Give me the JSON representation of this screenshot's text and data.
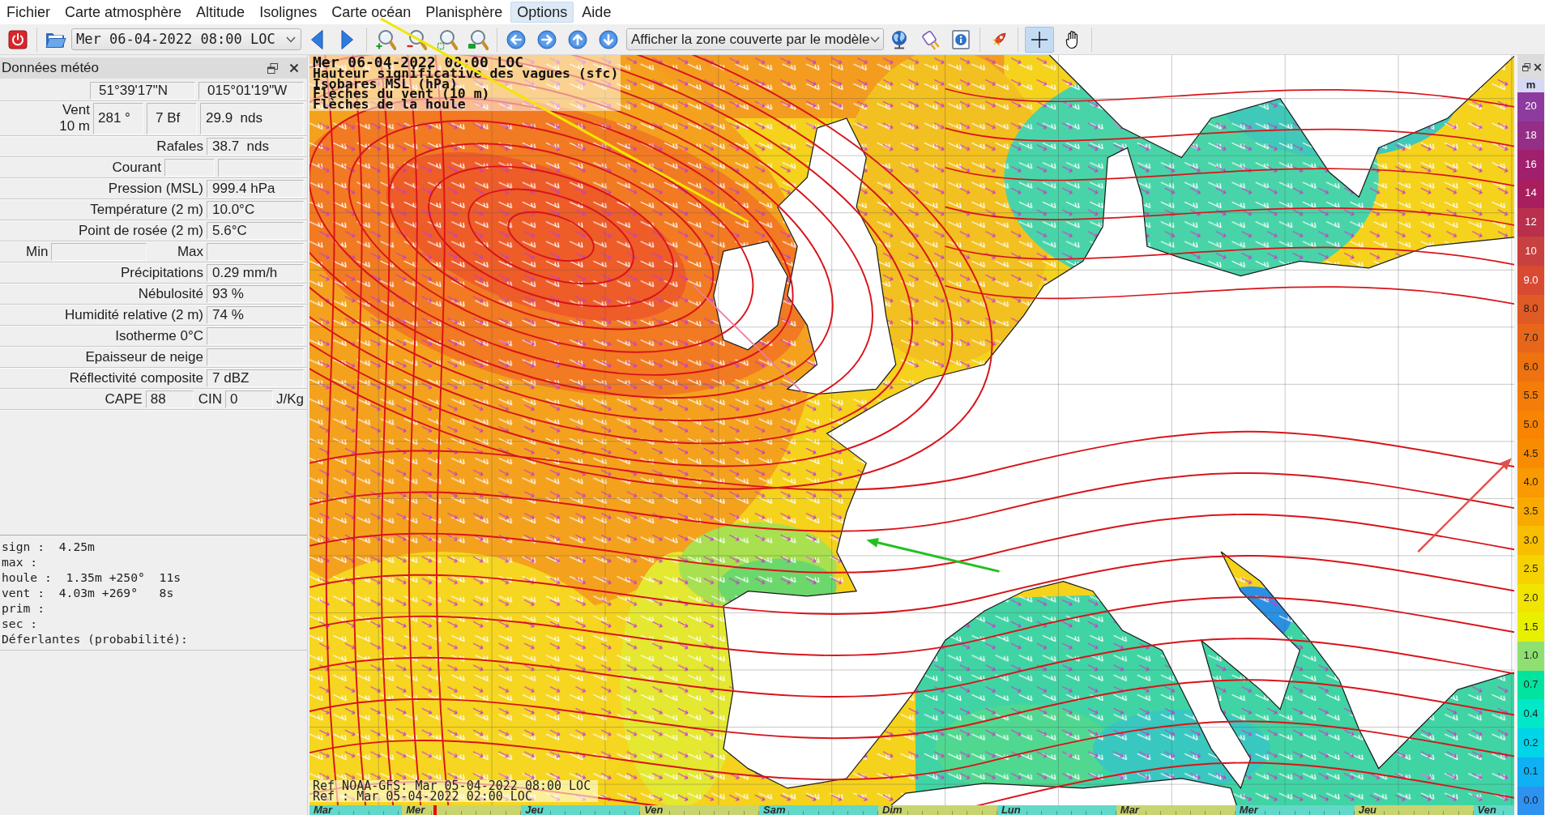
{
  "menu": [
    {
      "label": "Fichier",
      "selected": false
    },
    {
      "label": "Carte atmosphère",
      "selected": false
    },
    {
      "label": "Altitude",
      "selected": false
    },
    {
      "label": "Isolignes",
      "selected": false
    },
    {
      "label": "Carte océan",
      "selected": false
    },
    {
      "label": "Planisphère",
      "selected": false
    },
    {
      "label": "Options",
      "selected": true
    },
    {
      "label": "Aide",
      "selected": false
    }
  ],
  "toolbar": {
    "date_select": {
      "value": "Mer 06-04-2022 08:00 LOC"
    },
    "zone_select": {
      "value": "Afficher la zone couverte par le modèle"
    },
    "modes": [
      {
        "kind": "crosshair",
        "selected": true
      },
      {
        "kind": "hand",
        "selected": false
      }
    ]
  },
  "panel": {
    "title": "Données météo",
    "rows": [
      {
        "kind": "coords",
        "values": [
          "51°39'17\"N",
          "015°01'19\"W"
        ]
      },
      {
        "kind": "wind",
        "label": "Vent",
        "sublabel": "10 m",
        "values": [
          "281 °",
          "7 Bf",
          "29.9  nds"
        ]
      },
      {
        "kind": "single",
        "label": "Rafales",
        "value": "38.7  nds"
      },
      {
        "kind": "pair",
        "label": "Courant"
      },
      {
        "kind": "single",
        "label": "Pression (MSL)",
        "value": "999.4 hPa"
      },
      {
        "kind": "single",
        "label": "Température (2 m)",
        "value": "10.0°C"
      },
      {
        "kind": "single",
        "label": "Point de rosée (2 m)",
        "value": "5.6°C"
      },
      {
        "kind": "minmax",
        "min_label": "Min",
        "max_label": "Max"
      },
      {
        "kind": "single",
        "label": "Précipitations",
        "value": "0.29 mm/h"
      },
      {
        "kind": "single",
        "label": "Nébulosité",
        "value": "93 %"
      },
      {
        "kind": "single",
        "label": "Humidité relative (2 m)",
        "value": "74 %"
      },
      {
        "kind": "single",
        "label": "Isotherme 0°C"
      },
      {
        "kind": "single",
        "label": "Epaisseur de neige"
      },
      {
        "kind": "single",
        "label": "Réflectivité composite",
        "value": "7 dBZ"
      },
      {
        "kind": "cape",
        "label": "CAPE",
        "value": "88",
        "label_2": "CIN",
        "value_2": "0",
        "unit": "J/Kg"
      }
    ],
    "wave_info": [
      "sign :  4.25m",
      "max :",
      "houle :  1.35m +250°  11s",
      "vent :  4.03m +269°   8s",
      "prim :",
      "sec :",
      "Déferlantes (probabilité):"
    ]
  },
  "map": {
    "title_lines": [
      "Mer 06-04-2022 08:00 LOC",
      "Hauteur significative des vagues (sfc)",
      "Isobares MSL (hPa)",
      "Flèches du vent (10 m)",
      "Flèches de la houle"
    ],
    "ref_lines": [
      "Ref NOAA-GFS: Mar 05-04-2022 08:00 LOC",
      "Ref : Mar 05-04-2022 02:00 LOC"
    ]
  },
  "legend": {
    "unit": "m",
    "steps": [
      {
        "label": "20",
        "color": "#8d3b9e"
      },
      {
        "label": "18",
        "color": "#952e86"
      },
      {
        "label": "16",
        "color": "#a0206e"
      },
      {
        "label": "14",
        "color": "#a81e5e"
      },
      {
        "label": "12",
        "color": "#b8304c"
      },
      {
        "label": "10",
        "color": "#c84040"
      },
      {
        "label": "9.0",
        "color": "#d84a32"
      },
      {
        "label": "8.0",
        "color": "#e05a26"
      },
      {
        "label": "7.0",
        "color": "#e8661a"
      },
      {
        "label": "6.0",
        "color": "#ee7210"
      },
      {
        "label": "5.5",
        "color": "#f47c08"
      },
      {
        "label": "5.0",
        "color": "#f88402"
      },
      {
        "label": "4.5",
        "color": "#f88c00"
      },
      {
        "label": "4.0",
        "color": "#f89a00"
      },
      {
        "label": "3.5",
        "color": "#f8aa00"
      },
      {
        "label": "3.0",
        "color": "#f8be00"
      },
      {
        "label": "2.5",
        "color": "#f6d200"
      },
      {
        "label": "2.0",
        "color": "#f0e400"
      },
      {
        "label": "1.5",
        "color": "#e8f000"
      },
      {
        "label": "1.0",
        "color": "#8ee070"
      },
      {
        "label": "0.7",
        "color": "#00e4a0"
      },
      {
        "label": "0.4",
        "color": "#00e8c8"
      },
      {
        "label": "0.2",
        "color": "#00d4e8"
      },
      {
        "label": "0.1",
        "color": "#10b0f4"
      },
      {
        "label": "0.0",
        "color": "#2e92f0"
      }
    ]
  },
  "timeline": {
    "days": [
      "Mar",
      "Mer",
      "Jeu",
      "Ven",
      "Sam",
      "Dim",
      "Lun",
      "Mar",
      "Mer",
      "Jeu",
      "Ven"
    ],
    "level": 0.103
  }
}
